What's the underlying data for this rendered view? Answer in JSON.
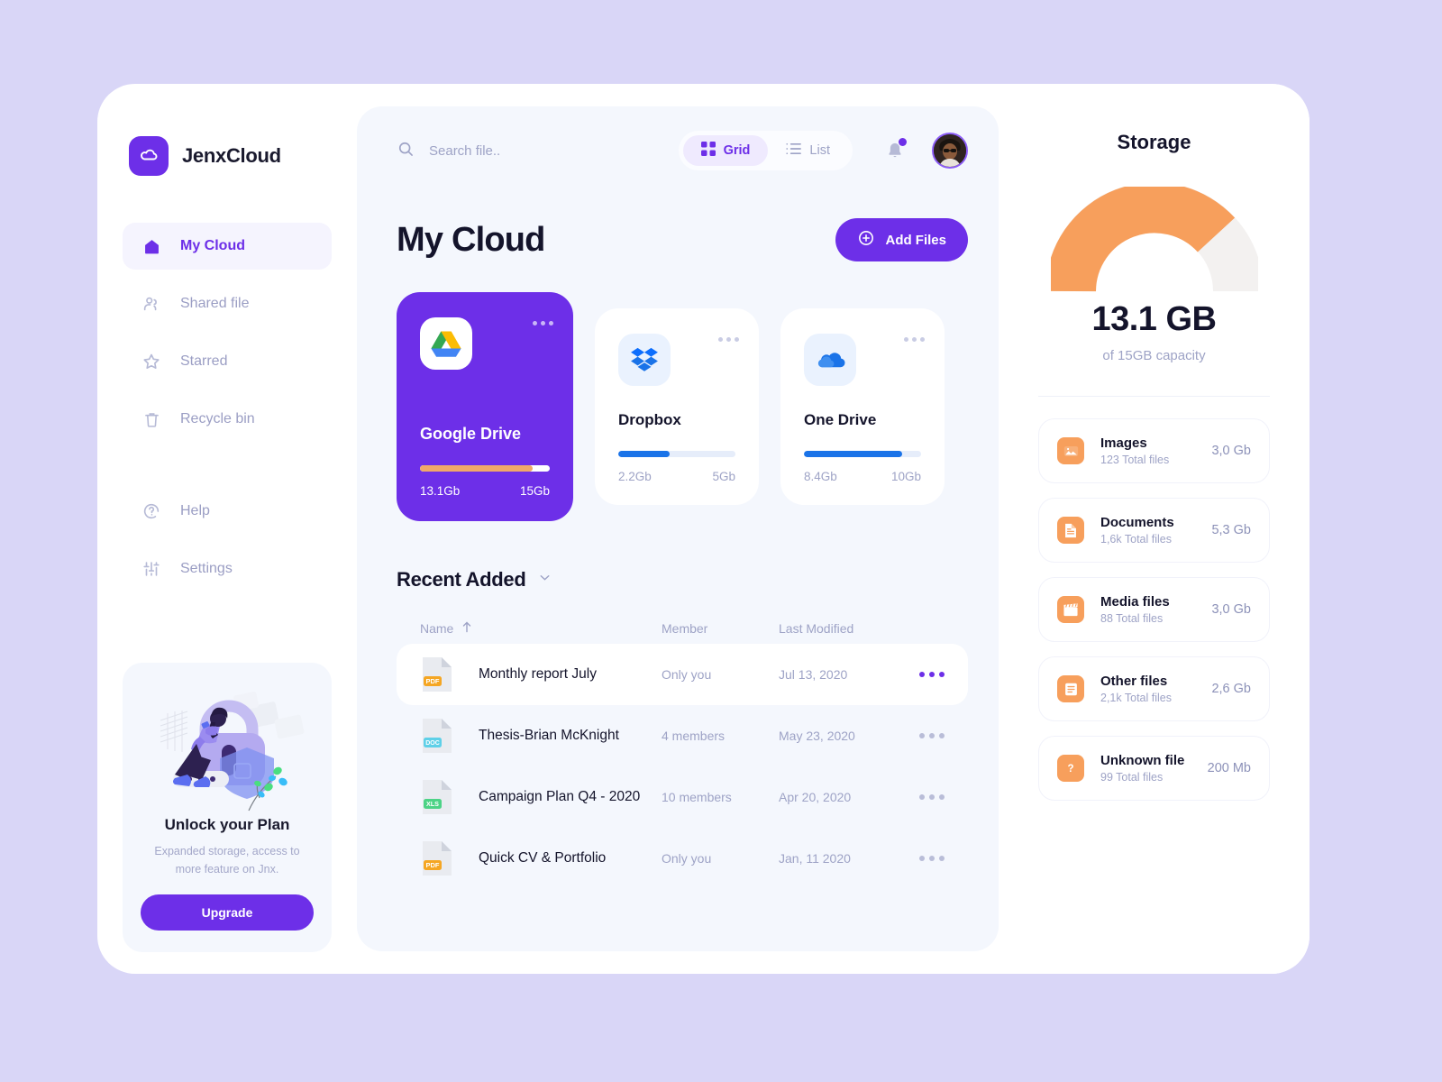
{
  "brand": {
    "name": "JenxCloud",
    "logo_icon": "cloud-icon",
    "logo_color": "#6d2fe8"
  },
  "sidebar": {
    "items": [
      {
        "label": "My Cloud",
        "icon": "home-icon",
        "active": true
      },
      {
        "label": "Shared file",
        "icon": "people-icon",
        "active": false
      },
      {
        "label": "Starred",
        "icon": "star-icon",
        "active": false
      },
      {
        "label": "Recycle bin",
        "icon": "trash-icon",
        "active": false
      },
      {
        "label": "Help",
        "icon": "question-circle-icon",
        "active": false
      },
      {
        "label": "Settings",
        "icon": "sliders-icon",
        "active": false
      }
    ],
    "promo": {
      "title": "Unlock your Plan",
      "subtitle": "Expanded storage, access to more feature on Jnx.",
      "button": "Upgrade",
      "art": "person-on-padlock-illustration"
    }
  },
  "topbar": {
    "search_placeholder": "Search file..",
    "search_value": "",
    "search_icon": "search-icon",
    "views": [
      {
        "label": "Grid",
        "icon": "grid-icon",
        "active": true
      },
      {
        "label": "List",
        "icon": "list-icon",
        "active": false
      }
    ],
    "bell_icon": "bell-icon",
    "has_notification": true,
    "avatar": "user-avatar"
  },
  "main": {
    "title": "My Cloud",
    "add_button": "Add Files",
    "add_icon": "plus-circle-icon",
    "services": [
      {
        "name": "Google Drive",
        "icon": "google-drive-icon",
        "used": "13.1Gb",
        "total": "15Gb",
        "percent": 87,
        "active": true
      },
      {
        "name": "Dropbox",
        "icon": "dropbox-icon",
        "used": "2.2Gb",
        "total": "5Gb",
        "percent": 44,
        "active": false
      },
      {
        "name": "One Drive",
        "icon": "onedrive-icon",
        "used": "8.4Gb",
        "total": "10Gb",
        "percent": 84,
        "active": false
      }
    ],
    "recent": {
      "title": "Recent Added",
      "chevron": "chevron-down-icon",
      "columns": {
        "name": "Name",
        "sort_icon": "sort-asc-arrow",
        "member": "Member",
        "modified": "Last Modified"
      },
      "rows": [
        {
          "name": "Monthly report July",
          "type": "PDF",
          "member": "Only you",
          "modified": "Jul 13, 2020",
          "selected": true
        },
        {
          "name": "Thesis-Brian McKnight",
          "type": "DOC",
          "member": "4 members",
          "modified": "May 23, 2020",
          "selected": false
        },
        {
          "name": "Campaign Plan Q4 - 2020",
          "type": "XLS",
          "member": "10 members",
          "modified": "Apr 20, 2020",
          "selected": false
        },
        {
          "name": "Quick CV & Portfolio",
          "type": "PDF",
          "member": "Only you",
          "modified": "Jan, 11 2020",
          "selected": false
        }
      ]
    }
  },
  "storage": {
    "title": "Storage",
    "used": "13.1 GB",
    "capacity_label": "of 15GB capacity",
    "percent": 87,
    "gauge_color": "#f79f5c",
    "gauge_track": "#f3f1f0",
    "items": [
      {
        "name": "Images",
        "files": "123 Total files",
        "size": "3,0 Gb",
        "icon": "image-icon"
      },
      {
        "name": "Documents",
        "files": "1,6k Total files",
        "size": "5,3 Gb",
        "icon": "document-icon"
      },
      {
        "name": "Media files",
        "files": "88 Total files",
        "size": "3,0 Gb",
        "icon": "clapperboard-icon"
      },
      {
        "name": "Other files",
        "files": "2,1k Total files",
        "size": "2,6 Gb",
        "icon": "list-box-icon"
      },
      {
        "name": "Unknown file",
        "files": "99 Total files",
        "size": "200 Mb",
        "icon": "question-icon"
      }
    ]
  },
  "colors": {
    "accent": "#6d2fe8",
    "orange": "#f79f5c",
    "blue": "#1a73e8",
    "muted": "#9ea3c6"
  }
}
